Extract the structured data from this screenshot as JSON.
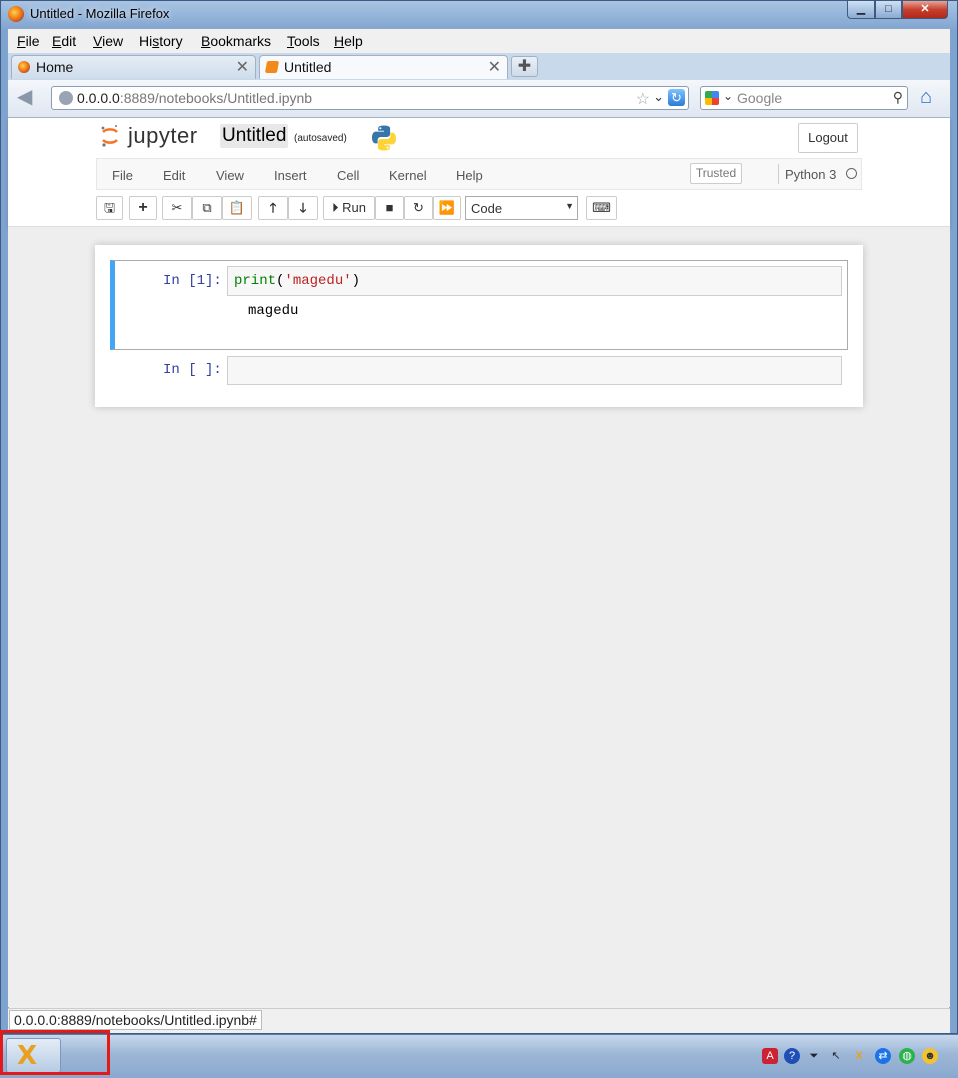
{
  "window": {
    "title": "Untitled - Mozilla Firefox",
    "controls": {
      "minimize": "▁",
      "maximize": "□",
      "close": "✕"
    }
  },
  "browser_menu": [
    {
      "label": "File",
      "accel": "F",
      "rest": "ile"
    },
    {
      "label": "Edit",
      "accel": "E",
      "rest": "dit"
    },
    {
      "label": "View",
      "accel": "V",
      "rest": "iew"
    },
    {
      "label": "History",
      "accel": "s",
      "pre": "Hi",
      "rest": "tory"
    },
    {
      "label": "Bookmarks",
      "accel": "B",
      "rest": "ookmarks"
    },
    {
      "label": "Tools",
      "accel": "T",
      "rest": "ools"
    },
    {
      "label": "Help",
      "accel": "H",
      "rest": "elp"
    }
  ],
  "tabs": [
    {
      "label": "Home",
      "icon": "firefox-icon",
      "active": false
    },
    {
      "label": "Untitled",
      "icon": "notebook-icon",
      "active": true
    }
  ],
  "new_tab": "✚",
  "urlbar": {
    "host": "0.0.0.0",
    "rest": ":8889/notebooks/Untitled.ipynb"
  },
  "searchbar": {
    "placeholder": "Google",
    "engine_icon": "google-icon"
  },
  "jupyter": {
    "logo_text": "jupyter",
    "notebook_name": "Untitled",
    "autosave_status": "(autosaved)",
    "logout_label": "Logout",
    "menu": [
      "File",
      "Edit",
      "View",
      "Insert",
      "Cell",
      "Kernel",
      "Help"
    ],
    "trusted_label": "Trusted",
    "kernel_name": "Python 3",
    "toolbar": {
      "run_label": "Run",
      "cell_type": "Code"
    }
  },
  "cells": [
    {
      "prompt": "In [1]:",
      "code": {
        "fn": "print",
        "open": "(",
        "str": "'magedu'",
        "close": ")"
      },
      "output": "magedu"
    },
    {
      "prompt": "In [ ]:",
      "code": "",
      "output": ""
    }
  ],
  "statusbar": {
    "text": "0.0.0.0:8889/notebooks/Untitled.ipynb#"
  },
  "colors": {
    "selected_cell_border": "#42a5f5",
    "prompt": "#303f9f",
    "highlight_box": "#e21a1a"
  }
}
